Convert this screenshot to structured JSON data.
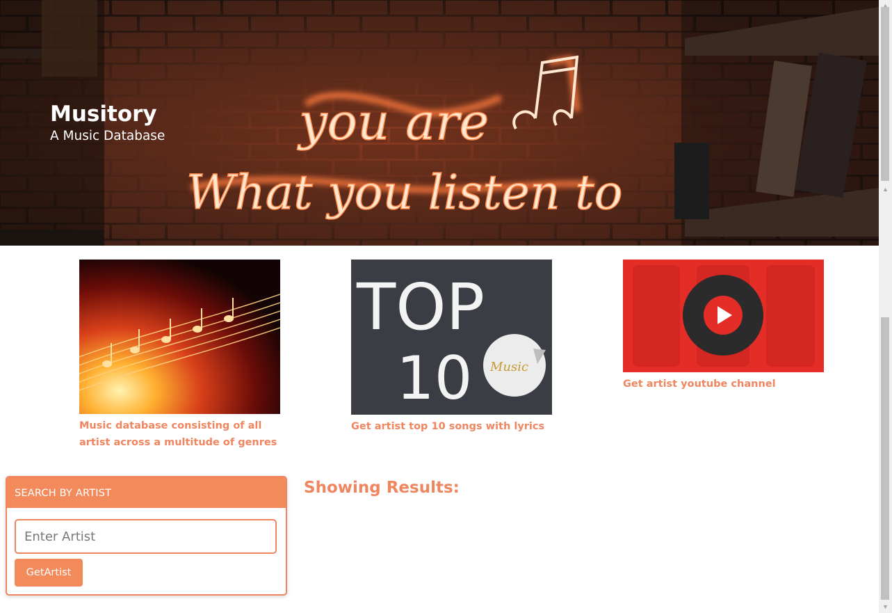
{
  "brand": {
    "title": "Musitory",
    "subtitle": "A Music Database"
  },
  "hero_neon": {
    "line1": "you are",
    "line2": "What you listen to"
  },
  "features": [
    {
      "caption": "Music database consisting of all artist across a multitude of genres",
      "icon": "music-notes-image"
    },
    {
      "caption": "Get artist top 10 songs with lyrics",
      "icon": "top-10-chalkboard-image",
      "chalk_top": "TOP",
      "chalk_num": "10",
      "sticker": "Music"
    },
    {
      "caption": "Get artist youtube channel",
      "icon": "youtube-music-image"
    }
  ],
  "search": {
    "header": "SEARCH BY ARTIST",
    "placeholder": "Enter Artist",
    "value": "",
    "button": "GetArtist"
  },
  "results": {
    "title": "Showing Results:"
  },
  "colors": {
    "accent": "#f38a5c",
    "accent_text": "#f08660",
    "youtube_red": "#e52d27"
  }
}
